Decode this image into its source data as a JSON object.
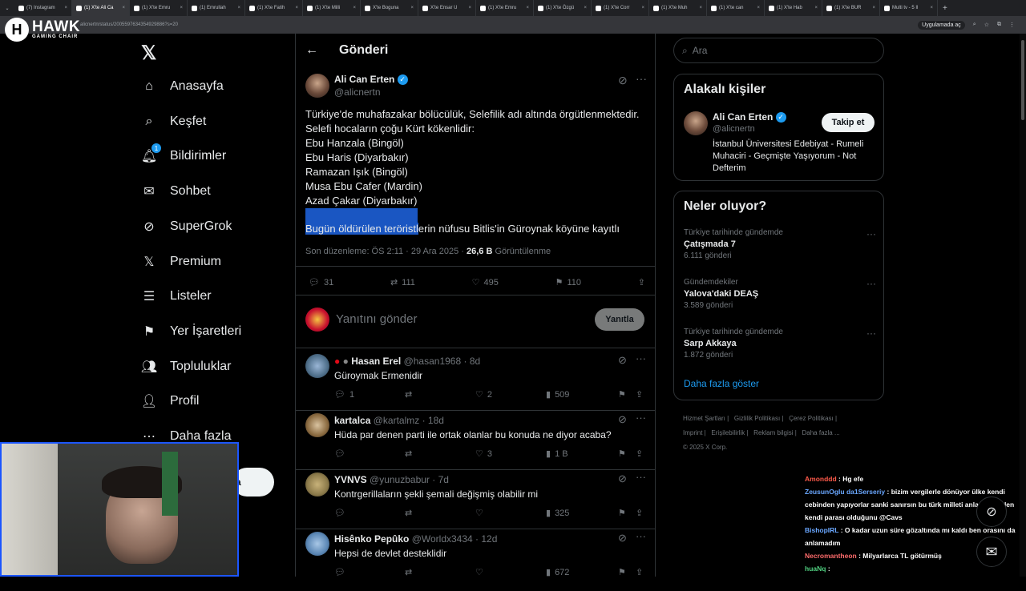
{
  "browser": {
    "tabs": [
      "(7) Instagram",
      "(1) X'te Ali Ca",
      "(1) X'te Emru",
      "(1) Emrullah",
      "(1) X'te Fatih",
      "(1) X'te Milli",
      "X'te Boguna",
      "X'te Ensar U",
      "(1) X'te Emru",
      "(1) X'te Özgü",
      "(1) X'te Corr",
      "(1) X'te Muh",
      "(1) X'te can",
      "(1) X'te Hab",
      "(1) X'te BUR",
      "Multi tv - 5 Il"
    ],
    "url": "alicnertn/status/2005597634354929886?s=20",
    "open_in_app": "Uygulamada aç"
  },
  "overlay_logo": {
    "brand": "HAWK",
    "tagline": "GAMING CHAIR"
  },
  "nav": {
    "items": [
      {
        "label": "Anasayfa",
        "icon": "home-icon"
      },
      {
        "label": "Keşfet",
        "icon": "search-icon"
      },
      {
        "label": "Bildirimler",
        "icon": "bell-icon",
        "badge": "1"
      },
      {
        "label": "Sohbet",
        "icon": "mail-icon"
      },
      {
        "label": "SuperGrok",
        "icon": "grok-icon"
      },
      {
        "label": "Premium",
        "icon": "x-icon"
      },
      {
        "label": "Listeler",
        "icon": "list-icon"
      },
      {
        "label": "Yer İşaretleri",
        "icon": "bookmark-icon"
      },
      {
        "label": "Topluluklar",
        "icon": "people-icon"
      },
      {
        "label": "Profil",
        "icon": "person-icon"
      },
      {
        "label": "Daha fazla",
        "icon": "more-circle-icon"
      }
    ],
    "post_button_partial": "a"
  },
  "header": {
    "title": "Gönderi"
  },
  "post": {
    "author_name": "Ali Can Erten",
    "author_handle": "@alicnertn",
    "lines": [
      "Türkiye'de muhafazakar bölücülük, Selefilik adı altında örgütlenmektedir.",
      "Selefi hocaların çoğu Kürt kökenlidir:",
      "Ebu Hanzala (Bingöl)",
      "Ebu Haris (Diyarbakır)",
      "Ramazan Işık (Bingöl)",
      "Musa Ebu Cafer (Mardin)",
      "Azad Çakar (Diyarbakır)"
    ],
    "last_line_selected": "Bugün öldürülen teröristl",
    "last_line_rest": "erin nüfusu Bitlis'in Güroynak köyüne kayıtlı",
    "meta_prefix": "Son düzenleme: ÖS 2:11 · 29 Ara 2025 · ",
    "views": "26,6 B",
    "views_label": "Görüntülenme",
    "replies": "31",
    "reposts": "111",
    "likes": "495",
    "bookmarks": "110"
  },
  "composer": {
    "placeholder": "Yanıtını gönder",
    "button": "Yanıtla"
  },
  "replies": [
    {
      "name": "Hasan Erel",
      "handle": "@hasan1968",
      "time": "8d",
      "text": "Güroymak Ermenidir",
      "replies": "1",
      "likes": "2",
      "views": "509"
    },
    {
      "name": "kartalca",
      "handle": "@kartalmz",
      "time": "18d",
      "text": "Hüda par denen parti ile ortak olanlar bu konuda ne diyor acaba?",
      "replies": "",
      "likes": "3",
      "views": "1 B"
    },
    {
      "name": "YVNVS",
      "handle": "@yunuzbabur",
      "time": "7d",
      "text": "Kontrgerillaların şekli şemali değişmiş olabilir mi",
      "replies": "",
      "likes": "",
      "views": "325"
    },
    {
      "name": "Hisênko Pepûko",
      "handle": "@Worldx3434",
      "time": "12d",
      "text": "Hepsi de devlet desteklidir",
      "replies": "",
      "likes": "",
      "views": "672"
    }
  ],
  "right": {
    "search_placeholder": "Ara",
    "related_title": "Alakalı kişiler",
    "related_name": "Ali Can Erten",
    "related_handle": "@alicnertn",
    "follow_label": "Takip et",
    "related_bio": "İstanbul Üniversitesi Edebiyat - Rumeli Muhaciri - Geçmişte Yaşıyorum - Not Defterim",
    "trends_title": "Neler oluyor?",
    "trends": [
      {
        "cat": "Türkiye tarihinde gündemde",
        "name": "Çatışmada 7",
        "count": "6.111 gönderi"
      },
      {
        "cat": "Gündemdekiler",
        "name": "Yalova'daki DEAŞ",
        "count": "3.589 gönderi"
      },
      {
        "cat": "Türkiye tarihinde gündemde",
        "name": "Sarp Akkaya",
        "count": "1.872 gönderi"
      }
    ],
    "show_more": "Daha fazla göster",
    "footer": {
      "terms": "Hizmet Şartları",
      "privacy": "Gizlilik Politikası",
      "cookies": "Çerez Politikası",
      "imprint": "Imprint",
      "accessibility": "Erişilebilirlik",
      "ads": "Reklam bilgisi",
      "more": "Daha fazla ...",
      "copyright": "© 2025 X Corp."
    }
  },
  "chat": [
    {
      "user": "Amonddd",
      "msg": "Hg efe"
    },
    {
      "user": "ZeusunOglu da1Serseriy",
      "msg": "bizim vergilerle dönüyor ülke kendi cebinden yapıyorlar sanki sanırsın bu türk milleti anlamadı halen kendi parası olduğunu @Cavs"
    },
    {
      "user": "BishopIRL",
      "msg": "O kadar uzun süre gözaltında mı kaldı ben orasını da anlamadım"
    },
    {
      "user": "Necromantheon",
      "msg": "Milyarlarca TL götürmüş"
    },
    {
      "user": "huaNq",
      "msg": ""
    }
  ]
}
